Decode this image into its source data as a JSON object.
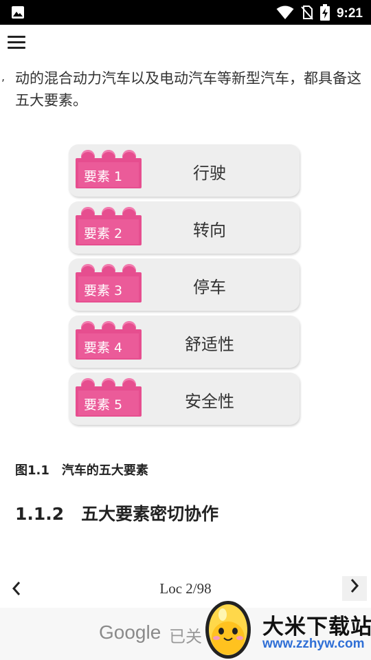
{
  "status_bar": {
    "time": "9:21",
    "icons": [
      "gallery-icon",
      "wifi-icon",
      "no-sim-icon",
      "battery-charging-icon"
    ]
  },
  "app_bar": {
    "menu_icon": "hamburger-menu-icon"
  },
  "content": {
    "paragraph": "动的混合动力汽车以及电动汽车等新型汽车，都具备这五大要素。",
    "figure": {
      "elements": [
        {
          "badge": "要素 1",
          "name": "行驶"
        },
        {
          "badge": "要素 2",
          "name": "转向"
        },
        {
          "badge": "要素 3",
          "name": "停车"
        },
        {
          "badge": "要素 4",
          "name": "舒适性"
        },
        {
          "badge": "要素 5",
          "name": "安全性"
        }
      ],
      "brick_color": "#e64e8f"
    },
    "caption": "图1.1　汽车的五大要素",
    "section_heading": "1.1.2　五大要素密切协作"
  },
  "page_nav": {
    "prev_icon": "chevron-left-icon",
    "next_icon": "chevron-right-icon",
    "location": "Loc 2/98"
  },
  "ad_banner": {
    "brand": "Google",
    "close_text": "已关"
  },
  "watermark": {
    "title": "大米下载站",
    "url": "www.zzhyw.com"
  }
}
